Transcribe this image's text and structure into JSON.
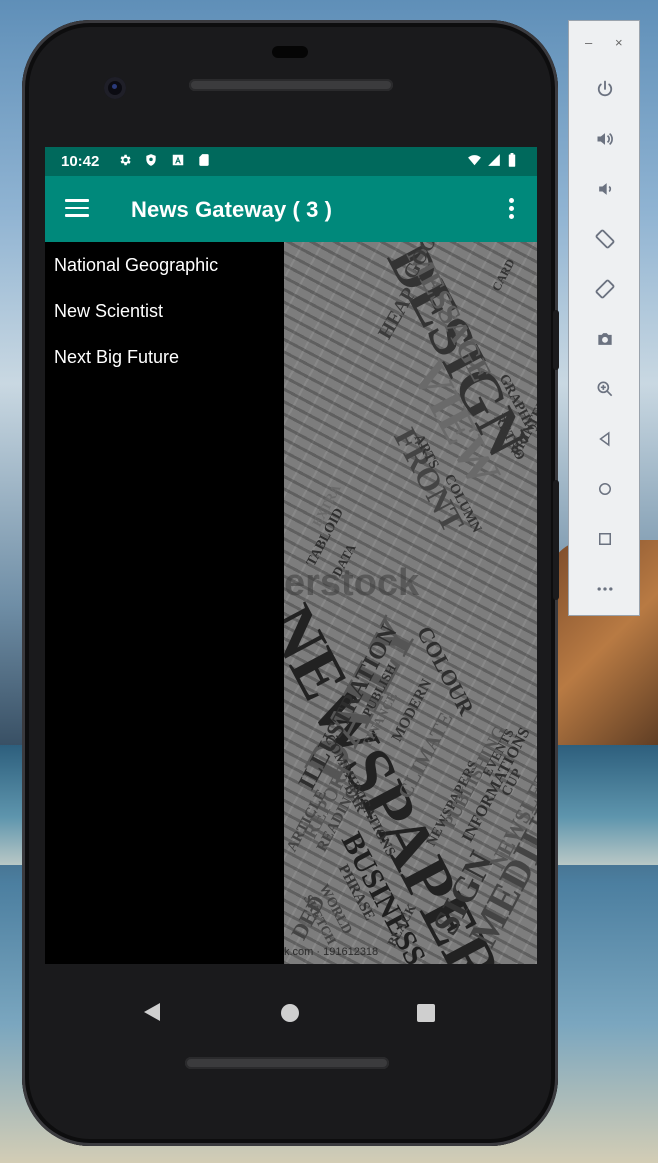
{
  "status_bar": {
    "time": "10:42"
  },
  "app_bar": {
    "title": "News Gateway ( 3 )"
  },
  "drawer": {
    "items": [
      {
        "label": "National Geographic"
      },
      {
        "label": "New Scientist"
      },
      {
        "label": "Next Big Future"
      }
    ]
  },
  "background_image": {
    "caption": "k.com · 191612318",
    "watermark": "erstock",
    "words": [
      "NEWSPAPER",
      "DESIGN",
      "DAILY",
      "MESSAGE",
      "GOOD",
      "HEAP",
      "VIEW",
      "FRONT",
      "ARTS",
      "COLUMN",
      "TABLOID",
      "DATA",
      "EXTRA",
      "PUBLISH",
      "ILLUSTRATION",
      "COLOUR",
      "MODERN",
      "CLIMATE",
      "NEWSPAPERS",
      "INFORMATIONS",
      "PUBLISHING",
      "COMMUNICATIONS",
      "BAR",
      "REPORT",
      "READING",
      "ARTICLE",
      "BUSINESS",
      "SIGN",
      "MEDIUM",
      "PHRASE",
      "WORLD",
      "SKETCH",
      "BLACK",
      "NEWSLETTER",
      "PRINTED",
      "GRAPHIC",
      "RETRO",
      "CARD",
      "EVENTS",
      "CUP",
      "FINANCE",
      "DED"
    ]
  },
  "emulator_toolbar": {
    "minimize": "–",
    "close": "×",
    "buttons": [
      "power-icon",
      "volume-up-icon",
      "volume-down-icon",
      "rotate-left-icon",
      "rotate-right-icon",
      "camera-icon",
      "zoom-icon",
      "back-icon",
      "home-icon",
      "overview-icon",
      "more-icon"
    ]
  },
  "colors": {
    "status_bar": "#00695c",
    "app_bar": "#00897b"
  }
}
